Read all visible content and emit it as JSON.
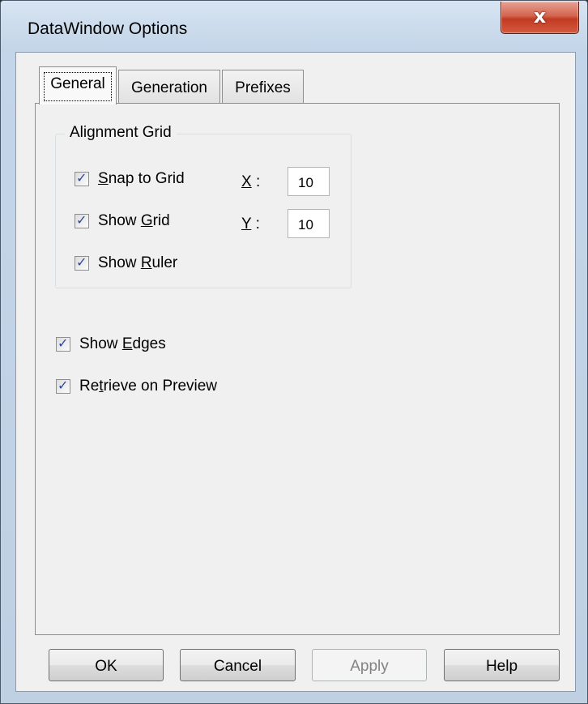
{
  "window": {
    "title": "DataWindow Options",
    "close_glyph": "x"
  },
  "tabs": [
    {
      "label": "General",
      "active": true
    },
    {
      "label": "Generation",
      "active": false
    },
    {
      "label": "Prefixes",
      "active": false
    }
  ],
  "alignment_grid": {
    "title": "Alignment Grid",
    "snap_to_grid": {
      "label_pre": "",
      "label_key": "S",
      "label_post": "nap to Grid",
      "checked": true
    },
    "show_grid": {
      "label_pre": "Show ",
      "label_key": "G",
      "label_post": "rid",
      "checked": true
    },
    "show_ruler": {
      "label_pre": "Show ",
      "label_key": "R",
      "label_post": "uler",
      "checked": true
    },
    "x": {
      "label_key": "X",
      "label_post": " :",
      "value": "10"
    },
    "y": {
      "label_key": "Y",
      "label_post": " :",
      "value": "10"
    }
  },
  "show_edges": {
    "label_pre": "Show ",
    "label_key": "E",
    "label_post": "dges",
    "checked": true
  },
  "retrieve_on_preview": {
    "label_pre": "Re",
    "label_key": "t",
    "label_post": "rieve on Preview",
    "checked": true
  },
  "buttons": {
    "ok": "OK",
    "cancel": "Cancel",
    "apply": "Apply",
    "help": "Help"
  },
  "icons": {
    "close": "close-icon",
    "check": "checkmark-icon"
  }
}
